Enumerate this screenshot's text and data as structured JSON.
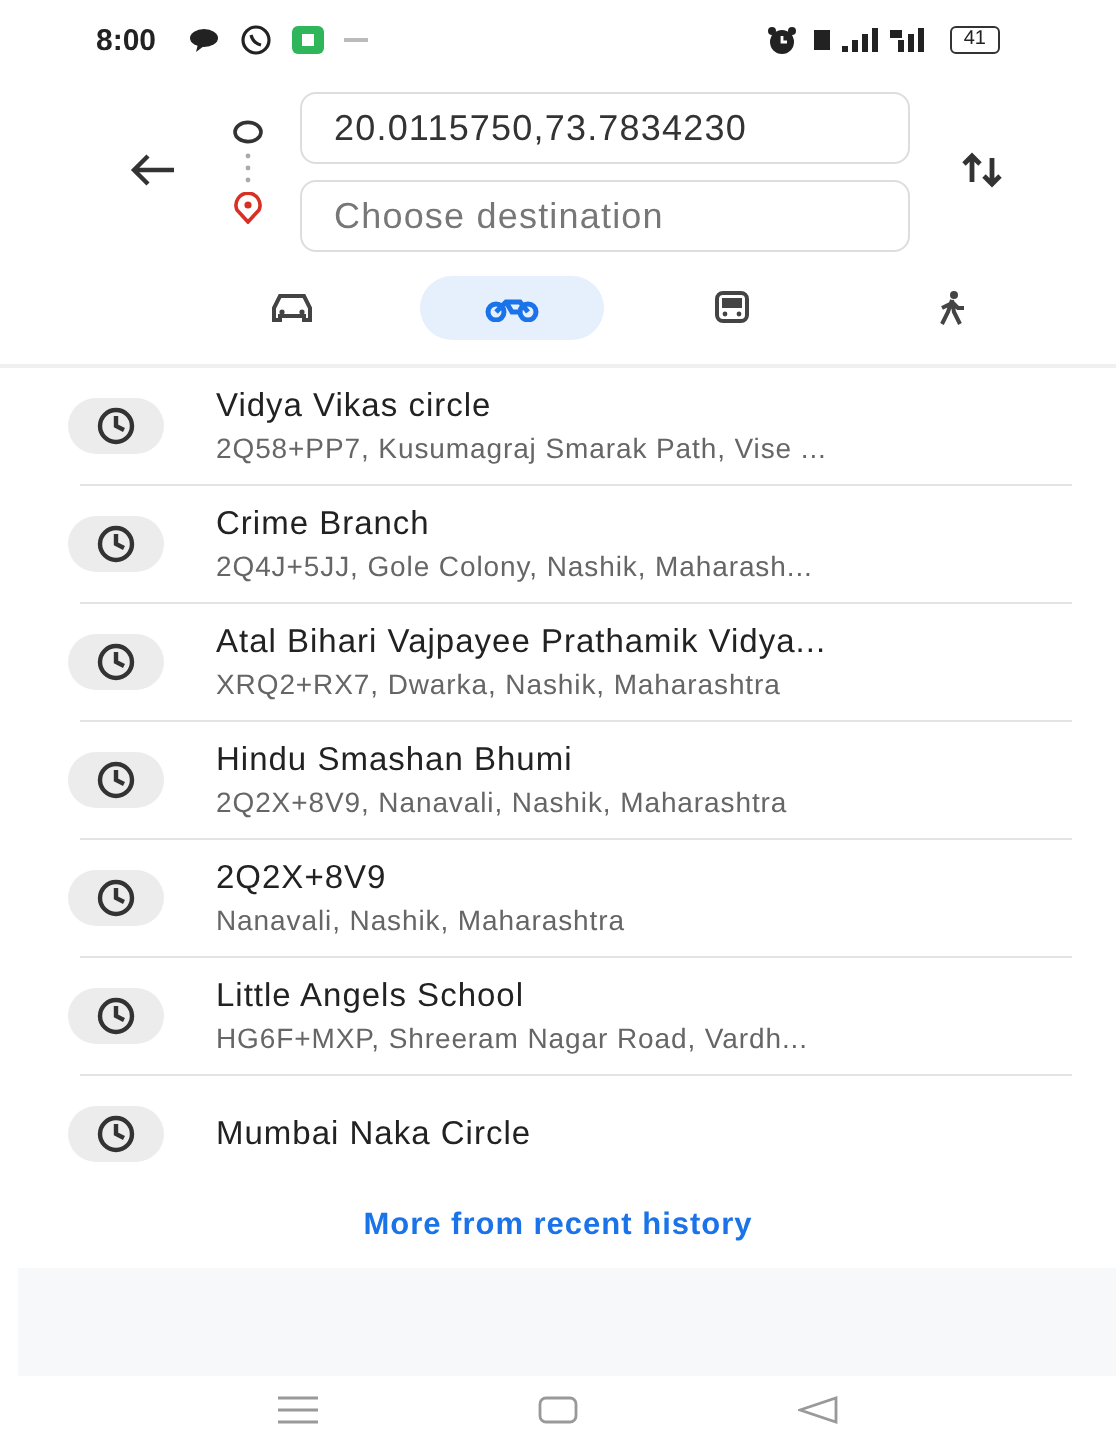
{
  "status_bar": {
    "time": "8:00",
    "battery": "41"
  },
  "directions": {
    "origin": {
      "value": "20.0115750,73.7834230"
    },
    "destination": {
      "placeholder": "Choose destination"
    }
  },
  "modes": [
    {
      "kind": "car",
      "selected": false
    },
    {
      "kind": "bike",
      "selected": true
    },
    {
      "kind": "transit",
      "selected": false
    },
    {
      "kind": "walk",
      "selected": false
    }
  ],
  "recent": [
    {
      "title": "Vidya Vikas circle",
      "subtitle": "2Q58+PP7, Kusumagraj Smarak Path, Vise ..."
    },
    {
      "title": "Crime Branch",
      "subtitle": "2Q4J+5JJ, Gole Colony, Nashik, Maharash..."
    },
    {
      "title": "Atal Bihari Vajpayee Prathamik Vidya...",
      "subtitle": "XRQ2+RX7, Dwarka, Nashik, Maharashtra"
    },
    {
      "title": "Hindu Smashan Bhumi",
      "subtitle": "2Q2X+8V9, Nanavali, Nashik, Maharashtra"
    },
    {
      "title": "2Q2X+8V9",
      "subtitle": "Nanavali, Nashik, Maharashtra"
    },
    {
      "title": "Little Angels School",
      "subtitle": "HG6F+MXP, Shreeram Nagar Road, Vardh..."
    },
    {
      "title": "Mumbai Naka Circle"
    }
  ],
  "more_link": "More from recent history"
}
